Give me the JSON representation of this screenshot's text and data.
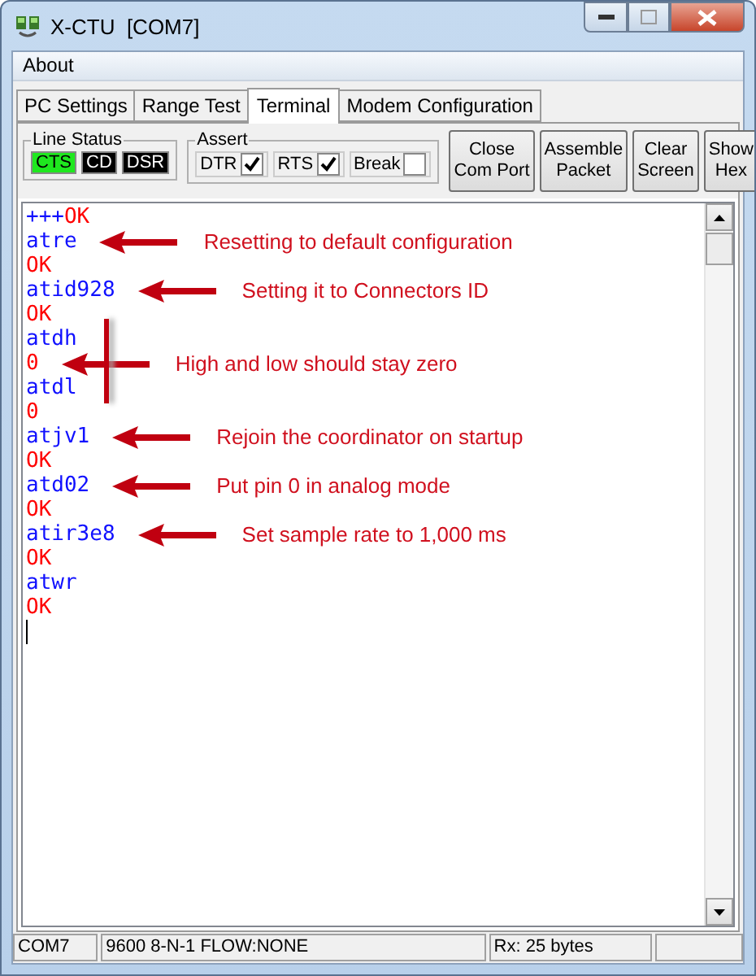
{
  "window": {
    "title": "X-CTU  [COM7]"
  },
  "menu": [
    "About"
  ],
  "tabs": [
    {
      "label": "PC Settings",
      "selected": false
    },
    {
      "label": "Range Test",
      "selected": false
    },
    {
      "label": "Terminal",
      "selected": true
    },
    {
      "label": "Modem Configuration",
      "selected": false
    }
  ],
  "line_status": {
    "label": "Line Status",
    "indicators": [
      {
        "label": "CTS",
        "on": true
      },
      {
        "label": "CD",
        "on": false
      },
      {
        "label": "DSR",
        "on": false
      }
    ]
  },
  "assert": {
    "label": "Assert",
    "items": [
      {
        "label": "DTR",
        "checked": true
      },
      {
        "label": "RTS",
        "checked": true
      },
      {
        "label": "Break",
        "checked": false
      }
    ]
  },
  "buttons": [
    "Close\nCom Port",
    "Assemble\nPacket",
    "Clear\nScreen",
    "Show\nHex"
  ],
  "terminal": {
    "lines": [
      {
        "segments": [
          {
            "text": "+++",
            "kind": "sent"
          },
          {
            "text": "OK",
            "kind": "received"
          }
        ]
      },
      {
        "segments": [
          {
            "text": "atre",
            "kind": "sent"
          }
        ],
        "note": "Resetting to default configuration"
      },
      {
        "segments": [
          {
            "text": "OK",
            "kind": "received"
          }
        ]
      },
      {
        "segments": [
          {
            "text": "atid928",
            "kind": "sent"
          }
        ],
        "note": "Setting it to Connectors ID"
      },
      {
        "segments": [
          {
            "text": "OK",
            "kind": "received"
          }
        ]
      },
      {
        "segments": [
          {
            "text": "atdh",
            "kind": "sent"
          }
        ]
      },
      {
        "segments": [
          {
            "text": "0",
            "kind": "received"
          }
        ],
        "note": "High and low should stay zero",
        "bracket": true
      },
      {
        "segments": [
          {
            "text": "atdl",
            "kind": "sent"
          }
        ]
      },
      {
        "segments": [
          {
            "text": "0",
            "kind": "received"
          }
        ]
      },
      {
        "segments": [
          {
            "text": "atjv1",
            "kind": "sent"
          }
        ],
        "note": "Rejoin the coordinator on startup"
      },
      {
        "segments": [
          {
            "text": "OK",
            "kind": "received"
          }
        ]
      },
      {
        "segments": [
          {
            "text": "atd02",
            "kind": "sent"
          }
        ],
        "note": "Put pin 0 in analog mode"
      },
      {
        "segments": [
          {
            "text": "OK",
            "kind": "received"
          }
        ]
      },
      {
        "segments": [
          {
            "text": "atir3e8",
            "kind": "sent"
          }
        ],
        "note": "Set sample rate to 1,000 ms"
      },
      {
        "segments": [
          {
            "text": "OK",
            "kind": "received"
          }
        ]
      },
      {
        "segments": [
          {
            "text": "atwr",
            "kind": "sent"
          }
        ]
      },
      {
        "segments": [
          {
            "text": "OK",
            "kind": "received"
          }
        ]
      }
    ]
  },
  "status_bar": [
    "COM7",
    "9600 8-N-1  FLOW:NONE",
    "Rx: 25 bytes"
  ]
}
